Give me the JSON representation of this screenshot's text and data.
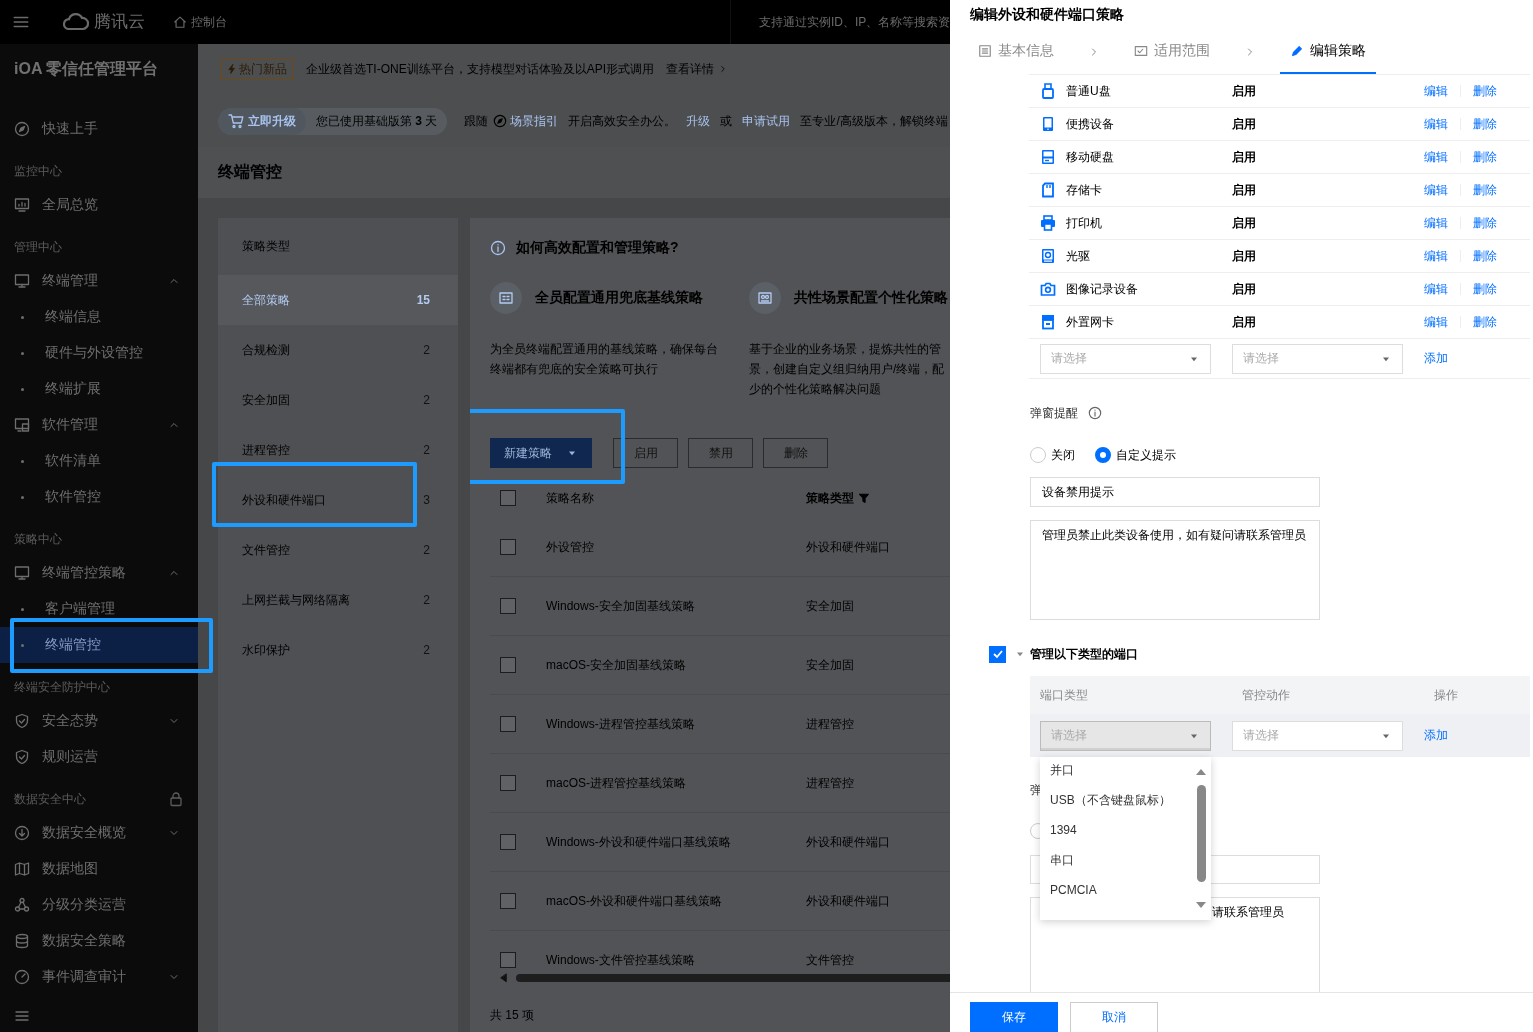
{
  "topbar": {
    "brand": "腾讯云",
    "console": "控制台",
    "search_placeholder": "支持通过实例ID、IP、名称等搜索资"
  },
  "sidebar": {
    "title": "iOA 零信任管理平台",
    "entries": [
      {
        "kind": "item",
        "label": "快速上手"
      },
      {
        "kind": "group",
        "label": "监控中心",
        "locked": false
      },
      {
        "kind": "item",
        "label": "全局总览"
      },
      {
        "kind": "group",
        "label": "管理中心",
        "locked": false
      },
      {
        "kind": "item",
        "label": "终端管理",
        "expanded": true,
        "children": [
          {
            "label": "终端信息",
            "selected": false,
            "highlighted": false
          },
          {
            "label": "硬件与外设管控",
            "selected": false,
            "highlighted": false
          },
          {
            "label": "终端扩展",
            "selected": false,
            "highlighted": false
          }
        ]
      },
      {
        "kind": "item",
        "label": "软件管理",
        "expanded": true,
        "children": [
          {
            "label": "软件清单",
            "selected": false,
            "highlighted": false
          },
          {
            "label": "软件管控",
            "selected": false,
            "highlighted": false
          }
        ]
      },
      {
        "kind": "group",
        "label": "策略中心",
        "locked": false
      },
      {
        "kind": "item",
        "label": "终端管控策略",
        "expanded": true,
        "children": [
          {
            "label": "客户端管理",
            "selected": false,
            "highlighted": false
          },
          {
            "label": "终端管控",
            "selected": true,
            "highlighted": true
          }
        ]
      },
      {
        "kind": "group",
        "label": "终端安全防护中心",
        "locked": false
      },
      {
        "kind": "item",
        "label": "安全态势",
        "expanded": false
      },
      {
        "kind": "item",
        "label": "规则运营"
      },
      {
        "kind": "group",
        "label": "数据安全中心",
        "locked": true
      },
      {
        "kind": "item",
        "label": "数据安全概览",
        "expanded": false
      },
      {
        "kind": "item",
        "label": "数据地图"
      },
      {
        "kind": "item",
        "label": "分级分类运营"
      },
      {
        "kind": "item",
        "label": "数据安全策略"
      },
      {
        "kind": "item",
        "label": "事件调查审计",
        "expanded": false
      }
    ]
  },
  "notice": {
    "tag": "热门新品",
    "text": "企业级首选TI-ONE训练平台，支持模型对话体验及以API形式调用",
    "link": "查看详情"
  },
  "upgrade": {
    "button": "立即升级",
    "usage": "您已使用基础版第 **3** 天",
    "message": [
      {
        "kind": "text",
        "text": "跟随"
      },
      {
        "kind": "guide_link",
        "text": "场景指引"
      },
      {
        "kind": "text",
        "text": "开启高效安全办公。"
      },
      {
        "kind": "link",
        "text": "升级"
      },
      {
        "kind": "text",
        "text": "或"
      },
      {
        "kind": "link",
        "text": "申请试用"
      },
      {
        "kind": "text",
        "text": "至专业/高级版本，解锁终端"
      }
    ]
  },
  "page_title": "终端管控",
  "strategy_types": {
    "header": "策略类型",
    "items": [
      {
        "label": "全部策略",
        "count": "15",
        "selected": true,
        "highlighted": false
      },
      {
        "label": "合规检测",
        "count": "2",
        "selected": false,
        "highlighted": false
      },
      {
        "label": "安全加固",
        "count": "2",
        "selected": false,
        "highlighted": false
      },
      {
        "label": "进程管控",
        "count": "2",
        "selected": false,
        "highlighted": false
      },
      {
        "label": "外设和硬件端口",
        "count": "3",
        "selected": false,
        "highlighted": true
      },
      {
        "label": "文件管控",
        "count": "2",
        "selected": false,
        "highlighted": false
      },
      {
        "label": "上网拦截与网络隔离",
        "count": "2",
        "selected": false,
        "highlighted": false
      },
      {
        "label": "水印保护",
        "count": "2",
        "selected": false,
        "highlighted": false
      }
    ]
  },
  "guide": {
    "title": "如何高效配置和管理策略?",
    "cards": [
      {
        "title": "全员配置通用兜底基线策略",
        "desc_lines": [
          "为全员终端配置通用的基线策略，确保每台",
          "终端都有兜底的安全策略可执行"
        ]
      },
      {
        "title": "共性场景配置个性化策略",
        "desc_lines": [
          "基于企业的业务场景，提炼共性的管",
          "景，创建自定义组归纳用户/终端，配",
          "少的个性化策略解决问题"
        ]
      }
    ]
  },
  "toolbar": {
    "highlighted": true,
    "buttons": [
      {
        "label": "新建策略",
        "kind": "primary"
      },
      {
        "label": "启用",
        "kind": "default"
      },
      {
        "label": "禁用",
        "kind": "default"
      },
      {
        "label": "删除",
        "kind": "default"
      }
    ]
  },
  "table": {
    "header_checked": false,
    "columns": [
      {
        "label": "策略名称",
        "filter": false
      },
      {
        "label": "策略类型",
        "filter": true
      }
    ],
    "rows": [
      {
        "checked": false,
        "name": "外设管控",
        "type": "外设和硬件端口"
      },
      {
        "checked": false,
        "name": "Windows-安全加固基线策略",
        "type": "安全加固"
      },
      {
        "checked": false,
        "name": "macOS-安全加固基线策略",
        "type": "安全加固"
      },
      {
        "checked": false,
        "name": "Windows-进程管控基线策略",
        "type": "进程管控"
      },
      {
        "checked": false,
        "name": "macOS-进程管控基线策略",
        "type": "进程管控"
      },
      {
        "checked": false,
        "name": "Windows-外设和硬件端口基线策略",
        "type": "外设和硬件端口"
      },
      {
        "checked": false,
        "name": "macOS-外设和硬件端口基线策略",
        "type": "外设和硬件端口"
      },
      {
        "checked": false,
        "name": "Windows-文件管控基线策略",
        "type": "文件管控"
      }
    ],
    "total": "共 15 项"
  },
  "drawer": {
    "title": "编辑外设和硬件端口策略",
    "steps": [
      {
        "label": "基本信息",
        "selected": false
      },
      {
        "label": "适用范围",
        "selected": false
      },
      {
        "label": "编辑策略",
        "selected": true
      }
    ],
    "devices": [
      {
        "name": "普通U盘",
        "status": "启用",
        "actions": [
          "编辑",
          "删除"
        ]
      },
      {
        "name": "便携设备",
        "status": "启用",
        "actions": [
          "编辑",
          "删除"
        ]
      },
      {
        "name": "移动硬盘",
        "status": "启用",
        "actions": [
          "编辑",
          "删除"
        ]
      },
      {
        "name": "存储卡",
        "status": "启用",
        "actions": [
          "编辑",
          "删除"
        ]
      },
      {
        "name": "打印机",
        "status": "启用",
        "actions": [
          "编辑",
          "删除"
        ]
      },
      {
        "name": "光驱",
        "status": "启用",
        "actions": [
          "编辑",
          "删除"
        ]
      },
      {
        "name": "图像记录设备",
        "status": "启用",
        "actions": [
          "编辑",
          "删除"
        ]
      },
      {
        "name": "外置网卡",
        "status": "启用",
        "actions": [
          "编辑",
          "删除"
        ]
      }
    ],
    "device_add": {
      "selects": [
        {
          "placeholder": "请选择"
        },
        {
          "placeholder": "请选择"
        }
      ],
      "action": "添加"
    },
    "reminder": {
      "label": "弹窗提醒",
      "options": [
        {
          "label": "关闭",
          "selected": false
        },
        {
          "label": "自定义提示",
          "selected": true
        }
      ],
      "title_value": "设备禁用提示",
      "message_value": "管理员禁止此类设备使用，如有疑问请联系管理员"
    },
    "ports": {
      "checked": true,
      "expanded": true,
      "title": "管理以下类型的端口",
      "columns": [
        "端口类型",
        "管控动作",
        "操作"
      ],
      "selects": [
        {
          "placeholder": "请选择",
          "open": true
        },
        {
          "placeholder": "请选择",
          "open": false
        }
      ],
      "action": "添加",
      "options": [
        "并口",
        "USB（不含键盘鼠标）",
        "1394",
        "串口",
        "PCMCIA"
      ]
    },
    "reminder2": {
      "label": "弹",
      "options": [
        {
          "selected": false
        }
      ],
      "message_tail": "请联系管理员"
    },
    "footer": [
      {
        "label": "保存",
        "kind": "primary"
      },
      {
        "label": "取消",
        "kind": "default"
      }
    ]
  }
}
